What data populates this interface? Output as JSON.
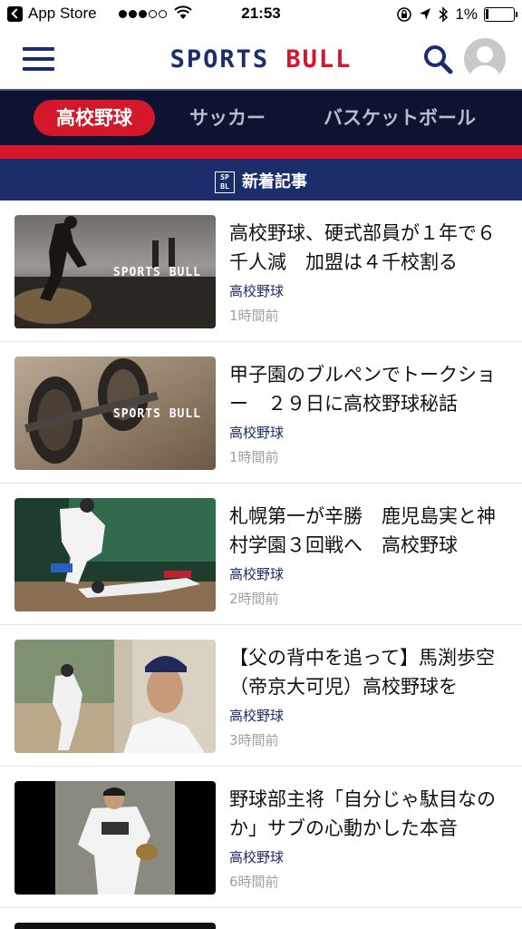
{
  "status_bar": {
    "carrier": "App Store",
    "time": "21:53",
    "battery": "1%"
  },
  "header": {
    "logo_part1": "SPORTS",
    "logo_part2": "BULL"
  },
  "tabs": [
    {
      "label": "高校野球",
      "active": true
    },
    {
      "label": "サッカー",
      "active": false
    },
    {
      "label": "バスケットボール",
      "active": false
    }
  ],
  "section": {
    "badge": "SP BL",
    "title": "新着記事"
  },
  "articles": [
    {
      "title": "高校野球、硬式部員が１年で６千人減　加盟は４千校割る",
      "category": "高校野球",
      "time": "1時間前",
      "watermark": "SPORTS BULL"
    },
    {
      "title": "甲子園のブルペンでトークショー　２９日に高校野球秘話",
      "category": "高校野球",
      "time": "1時間前",
      "watermark": "SPORTS BULL"
    },
    {
      "title": "札幌第一が辛勝　鹿児島実と神村学園３回戦へ　高校野球",
      "category": "高校野球",
      "time": "2時間前"
    },
    {
      "title": "【父の背中を追って】馬渕歩空（帝京大可児）高校野球を",
      "category": "高校野球",
      "time": "3時間前"
    },
    {
      "title": "野球部主将「自分じゃ駄目なのか」サブの心動かした本音",
      "category": "高校野球",
      "time": "6時間前"
    }
  ]
}
